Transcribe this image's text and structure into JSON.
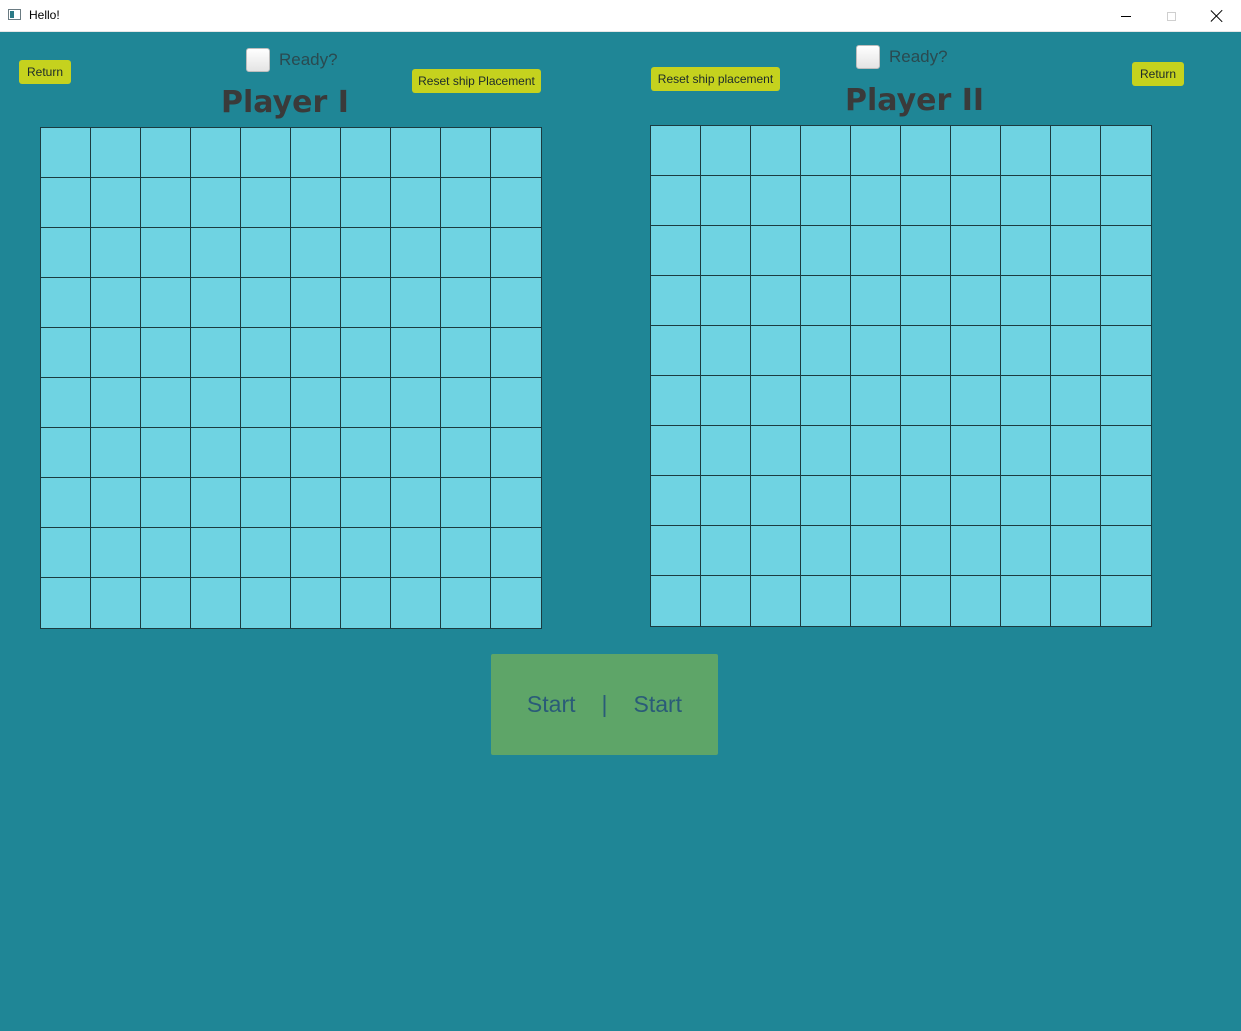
{
  "window": {
    "title": "Hello!"
  },
  "player1": {
    "name": "Player I",
    "return_label": "Return",
    "ready_label": "Ready?",
    "ready_checked": false,
    "reset_label": "Reset ship Placement",
    "grid_rows": 10,
    "grid_cols": 10
  },
  "player2": {
    "name": "Player II",
    "return_label": "Return",
    "ready_label": "Ready?",
    "ready_checked": false,
    "reset_label": "Reset ship placement",
    "grid_rows": 10,
    "grid_cols": 10
  },
  "start": {
    "left_label": "Start",
    "separator": "|",
    "right_label": "Start"
  },
  "colors": {
    "background": "#1f8696",
    "cell": "#6fd3e2",
    "button_yellow": "#c5d21e",
    "start_button": "#5ea568"
  },
  "icons": {
    "window_min": "minimize-icon",
    "window_max": "maximize-icon",
    "window_close": "close-icon",
    "app": "app-icon"
  }
}
